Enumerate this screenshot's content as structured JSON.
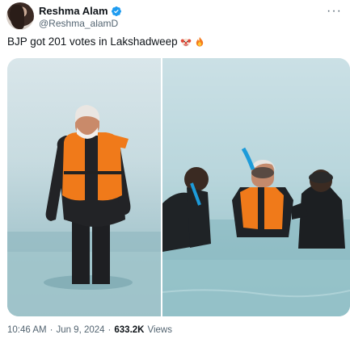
{
  "author": {
    "name": "Reshma Alam",
    "handle": "@Reshma_alamD",
    "verified": true
  },
  "tweet": {
    "text": "BJP got 201 votes in Lakshadweep",
    "emojis": [
      "clown-face-emoji",
      "fire-emoji"
    ]
  },
  "media": {
    "images": [
      {
        "name": "photo-man-in-life-jacket-wading"
      },
      {
        "name": "photo-man-snorkeling-with-divers"
      }
    ]
  },
  "meta": {
    "time": "10:46 AM",
    "separator1": "·",
    "date": "Jun 9, 2024",
    "separator2": "·",
    "views_count": "633.2K",
    "views_label": "Views"
  },
  "colors": {
    "verified": "#1d9bf0",
    "secondary_text": "#536471",
    "life_jacket": "#f07a1a"
  },
  "icons": {
    "more": "more-options-icon",
    "verified": "verified-badge-icon"
  }
}
